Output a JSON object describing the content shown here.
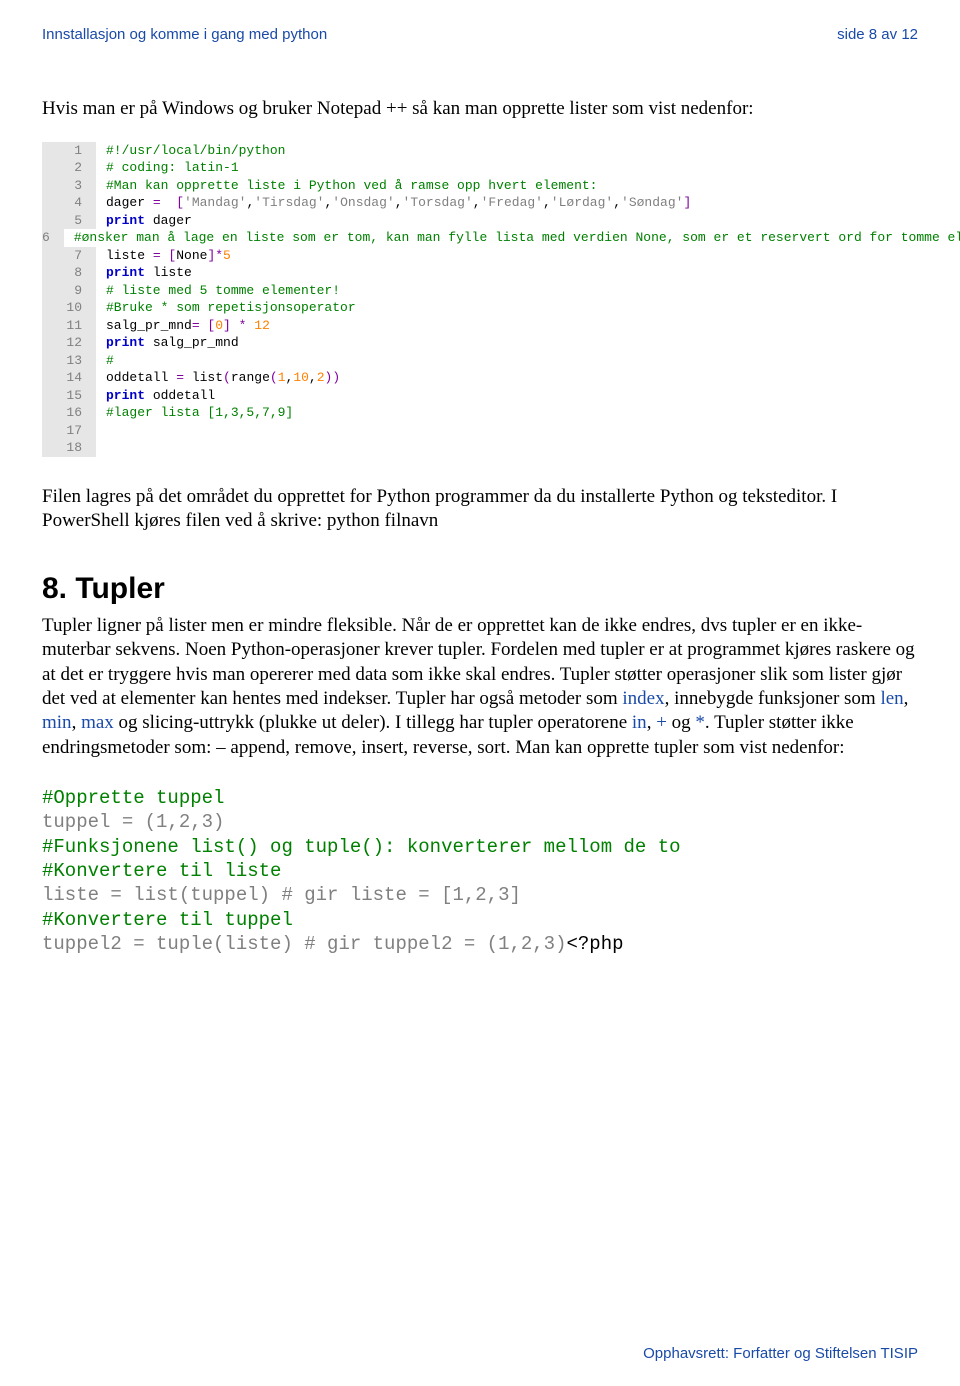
{
  "header": {
    "left": "Innstallasjon og komme i gang med python",
    "right": "side 8 av 12"
  },
  "intro_para": "Hvis man er på Windows og bruker Notepad ++ så kan man opprette lister som vist nedenfor:",
  "code_lines": [
    {
      "n": "1",
      "spans": [
        {
          "cls": "c-green",
          "t": "#!/usr/local/bin/python"
        }
      ]
    },
    {
      "n": "2",
      "spans": [
        {
          "cls": "c-green",
          "t": "# coding: latin-1"
        }
      ]
    },
    {
      "n": "3",
      "spans": [
        {
          "cls": "c-green",
          "t": "#Man kan opprette liste i Python ved å ramse opp hvert element:"
        }
      ]
    },
    {
      "n": "4",
      "spans": [
        {
          "cls": "c-black",
          "t": "dager "
        },
        {
          "cls": "c-purple",
          "t": "=  "
        },
        {
          "cls": "c-purple",
          "t": "["
        },
        {
          "cls": "c-gray",
          "t": "'Mandag'"
        },
        {
          "cls": "c-black",
          "t": ","
        },
        {
          "cls": "c-gray",
          "t": "'Tirsdag'"
        },
        {
          "cls": "c-black",
          "t": ","
        },
        {
          "cls": "c-gray",
          "t": "'Onsdag'"
        },
        {
          "cls": "c-black",
          "t": ","
        },
        {
          "cls": "c-gray",
          "t": "'Torsdag'"
        },
        {
          "cls": "c-black",
          "t": ","
        },
        {
          "cls": "c-gray",
          "t": "'Fredag'"
        },
        {
          "cls": "c-black",
          "t": ","
        },
        {
          "cls": "c-gray",
          "t": "'Lørdag'"
        },
        {
          "cls": "c-black",
          "t": ","
        },
        {
          "cls": "c-gray",
          "t": "'Søndag'"
        },
        {
          "cls": "c-purple",
          "t": "]"
        }
      ]
    },
    {
      "n": "5",
      "spans": [
        {
          "cls": "c-blue",
          "t": "print"
        },
        {
          "cls": "c-black",
          "t": " dager"
        }
      ]
    },
    {
      "n": "6",
      "spans": [
        {
          "cls": "c-green",
          "t": "#ønsker man å lage en liste som er tom, kan man fylle lista med verdien None, som er et reservert ord for tomme elementer:"
        }
      ]
    },
    {
      "n": "7",
      "spans": [
        {
          "cls": "c-black",
          "t": "liste "
        },
        {
          "cls": "c-purple",
          "t": "= ["
        },
        {
          "cls": "c-black",
          "t": "None"
        },
        {
          "cls": "c-purple",
          "t": "]*"
        },
        {
          "cls": "c-orange",
          "t": "5"
        }
      ]
    },
    {
      "n": "8",
      "spans": [
        {
          "cls": "c-blue",
          "t": "print"
        },
        {
          "cls": "c-black",
          "t": " liste"
        }
      ]
    },
    {
      "n": "9",
      "spans": [
        {
          "cls": "c-green",
          "t": "# liste med 5 tomme elementer!"
        }
      ]
    },
    {
      "n": "10",
      "spans": [
        {
          "cls": "c-green",
          "t": "#Bruke * som repetisjonsoperator"
        }
      ]
    },
    {
      "n": "11",
      "spans": [
        {
          "cls": "c-black",
          "t": "salg_pr_mnd"
        },
        {
          "cls": "c-purple",
          "t": "= ["
        },
        {
          "cls": "c-orange",
          "t": "0"
        },
        {
          "cls": "c-purple",
          "t": "] * "
        },
        {
          "cls": "c-orange",
          "t": "12"
        }
      ]
    },
    {
      "n": "12",
      "spans": [
        {
          "cls": "c-blue",
          "t": "print"
        },
        {
          "cls": "c-black",
          "t": " salg_pr_mnd"
        }
      ]
    },
    {
      "n": "13",
      "spans": [
        {
          "cls": "c-green",
          "t": "#"
        }
      ]
    },
    {
      "n": "14",
      "spans": [
        {
          "cls": "c-black",
          "t": "oddetall "
        },
        {
          "cls": "c-purple",
          "t": "= "
        },
        {
          "cls": "c-black",
          "t": "list"
        },
        {
          "cls": "c-purple",
          "t": "("
        },
        {
          "cls": "c-black",
          "t": "range"
        },
        {
          "cls": "c-purple",
          "t": "("
        },
        {
          "cls": "c-orange",
          "t": "1"
        },
        {
          "cls": "c-black",
          "t": ","
        },
        {
          "cls": "c-orange",
          "t": "10"
        },
        {
          "cls": "c-black",
          "t": ","
        },
        {
          "cls": "c-orange",
          "t": "2"
        },
        {
          "cls": "c-purple",
          "t": "))"
        }
      ]
    },
    {
      "n": "15",
      "spans": [
        {
          "cls": "c-blue",
          "t": "print"
        },
        {
          "cls": "c-black",
          "t": " oddetall"
        }
      ]
    },
    {
      "n": "16",
      "spans": [
        {
          "cls": "c-green",
          "t": "#lager lista [1,3,5,7,9]"
        }
      ]
    },
    {
      "n": "17",
      "spans": [
        {
          "cls": "c-black",
          "t": ""
        }
      ]
    },
    {
      "n": "18",
      "spans": [
        {
          "cls": "c-black",
          "t": ""
        }
      ],
      "hl": true
    }
  ],
  "after_code_para": "Filen lagres på det området du opprettet for Python programmer da du installerte Python og teksteditor. I PowerShell kjøres filen ved å skrive: python filnavn",
  "heading": "8. Tupler",
  "body_parts": [
    {
      "t": "Tupler ligner på lister men er mindre fleksible. Når de er opprettet kan de ikke endres, dvs tupler er en ikke-muterbar sekvens. Noen Python-operasjoner krever tupler. Fordelen med tupler er at programmet kjøres raskere og at det er tryggere hvis man opererer med data som ikke skal endres. Tupler støtter operasjoner slik som lister gjør det ved at elementer kan hentes med indekser. Tupler har også metoder som "
    },
    {
      "t": "index",
      "link": true
    },
    {
      "t": ", innebygde funksjoner som "
    },
    {
      "t": "len",
      "link": true
    },
    {
      "t": ", "
    },
    {
      "t": "min",
      "link": true
    },
    {
      "t": ", "
    },
    {
      "t": "max",
      "link": true
    },
    {
      "t": " og slicing-uttrykk (plukke ut deler). I tillegg har tupler operatorene "
    },
    {
      "t": "in",
      "link": true
    },
    {
      "t": ", "
    },
    {
      "t": "+",
      "link": true
    },
    {
      "t": " og "
    },
    {
      "t": "*",
      "link": true
    },
    {
      "t": ". Tupler støtter ikke endringsmetoder som: – append, remove, insert, reverse, sort. Man kan opprette tupler som vist nedenfor:"
    }
  ],
  "code2_lines": [
    [
      {
        "cls": "cb-comment",
        "t": "#Opprette tuppel"
      }
    ],
    [
      {
        "cls": "cb-gray",
        "t": "tuppel = (1,2,3)"
      }
    ],
    [
      {
        "cls": "cb-black",
        "t": " "
      }
    ],
    [
      {
        "cls": "cb-comment",
        "t": "#Funksjonene list() og tuple(): konverterer mellom de to"
      }
    ],
    [
      {
        "cls": "cb-comment",
        "t": "#Konvertere til liste"
      }
    ],
    [
      {
        "cls": "cb-gray",
        "t": "liste = list(tuppel) # gir liste = [1,2,3]"
      }
    ],
    [
      {
        "cls": "cb-black",
        "t": " "
      }
    ],
    [
      {
        "cls": "cb-comment",
        "t": "#Konvertere til tuppel"
      }
    ],
    [
      {
        "cls": "cb-gray",
        "t": "tuppel2 = tuple(liste) # gir tuppel2 = (1,2,3)"
      },
      {
        "cls": "cb-black",
        "t": "<?php"
      }
    ]
  ],
  "footer": "Opphavsrett:  Forfatter og Stiftelsen TISIP"
}
